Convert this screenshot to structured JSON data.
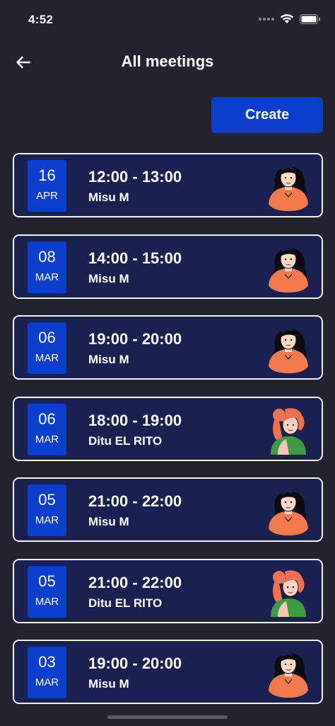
{
  "status_bar": {
    "time": "4:52"
  },
  "header": {
    "title": "All meetings",
    "back_icon": "arrow-left-icon"
  },
  "create_button": {
    "label": "Create",
    "color": "#0a3fce"
  },
  "meetings": [
    {
      "day": "16",
      "month": "APR",
      "time": "12:00 - 13:00",
      "host": "Misu M",
      "avatar": "female-avatar-dark-hair"
    },
    {
      "day": "08",
      "month": "MAR",
      "time": "14:00 - 15:00",
      "host": "Misu M",
      "avatar": "female-avatar-dark-hair"
    },
    {
      "day": "06",
      "month": "MAR",
      "time": "19:00 - 20:00",
      "host": "Misu M",
      "avatar": "female-avatar-dark-hair"
    },
    {
      "day": "06",
      "month": "MAR",
      "time": "18:00 - 19:00",
      "host": "Ditu EL RITO",
      "avatar": "female-avatar-red-hair"
    },
    {
      "day": "05",
      "month": "MAR",
      "time": "21:00 - 22:00",
      "host": "Misu M",
      "avatar": "female-avatar-dark-hair"
    },
    {
      "day": "05",
      "month": "MAR",
      "time": "21:00 - 22:00",
      "host": "Ditu EL RITO",
      "avatar": "female-avatar-red-hair"
    },
    {
      "day": "03",
      "month": "MAR",
      "time": "19:00 - 20:00",
      "host": "Misu M",
      "avatar": "female-avatar-dark-hair"
    }
  ],
  "colors": {
    "background": "#22232f",
    "card": "#1a2150",
    "accent": "#0a3fce",
    "card_border": "#f2f2f6"
  }
}
